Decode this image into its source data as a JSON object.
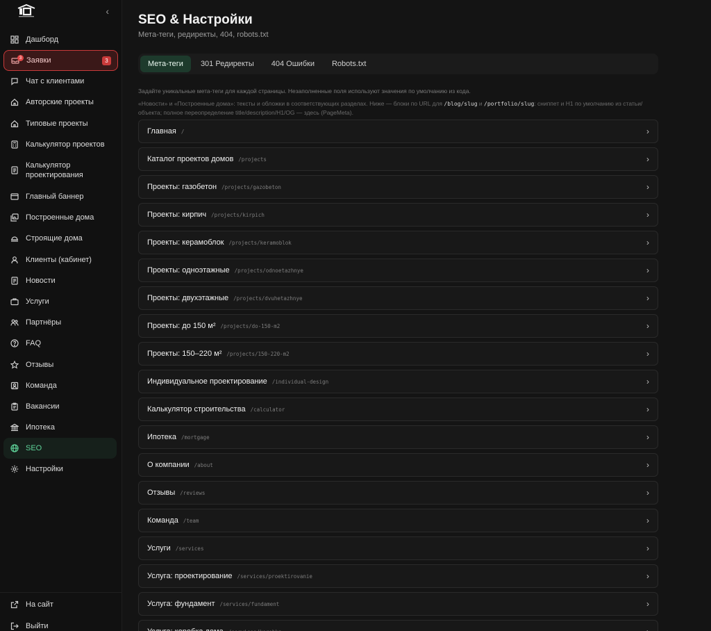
{
  "sidebar": {
    "collapse_glyph": "‹",
    "items": [
      {
        "label": "Дашборд",
        "icon": "dashboard-icon"
      },
      {
        "label": "Заявки",
        "icon": "inbox-icon",
        "dot": "3",
        "count": "3"
      },
      {
        "label": "Чат с клиентами",
        "icon": "chat-icon"
      },
      {
        "label": "Авторские проекты",
        "icon": "home-icon"
      },
      {
        "label": "Типовые проекты",
        "icon": "home-icon"
      },
      {
        "label": "Калькулятор проектов",
        "icon": "calculator-icon"
      },
      {
        "label": "Калькулятор проектирования",
        "icon": "document-icon"
      },
      {
        "label": "Главный баннер",
        "icon": "banner-icon"
      },
      {
        "label": "Построенные дома",
        "icon": "gallery-icon"
      },
      {
        "label": "Строящие дома",
        "icon": "construction-icon"
      },
      {
        "label": "Клиенты (кабинет)",
        "icon": "user-icon"
      },
      {
        "label": "Новости",
        "icon": "news-icon"
      },
      {
        "label": "Услуги",
        "icon": "briefcase-icon"
      },
      {
        "label": "Партнёры",
        "icon": "partners-icon"
      },
      {
        "label": "FAQ",
        "icon": "question-icon"
      },
      {
        "label": "Отзывы",
        "icon": "star-icon"
      },
      {
        "label": "Команда",
        "icon": "team-icon"
      },
      {
        "label": "Вакансии",
        "icon": "clipboard-icon"
      },
      {
        "label": "Ипотека",
        "icon": "bank-icon"
      },
      {
        "label": "SEO",
        "icon": "globe-icon"
      },
      {
        "label": "Настройки",
        "icon": "gear-icon"
      }
    ],
    "bottom": [
      {
        "label": "На сайт",
        "icon": "external-link-icon"
      },
      {
        "label": "Выйти",
        "icon": "logout-icon"
      }
    ]
  },
  "header": {
    "title": "SEO & Настройки",
    "subtitle": "Мета-теги, редиректы, 404, robots.txt"
  },
  "tabs": [
    {
      "label": "Мета-теги",
      "active": true
    },
    {
      "label": "301 Редиректы",
      "active": false
    },
    {
      "label": "404 Ошибки",
      "active": false
    },
    {
      "label": "Robots.txt",
      "active": false
    }
  ],
  "hints": {
    "line1": "Задайте уникальные мета-теги для каждой страницы. Незаполненные поля используют значения по умолчанию из кода.",
    "line2_a": "«Новости» и «Построенные дома»: тексты и обложки в соответствующих разделах. Ниже — блоки по URL для ",
    "code1": "/blog/slug",
    "line2_b": " и ",
    "code2": "/portfolio/slug",
    "line2_c": ": сниппет и H1 по умолчанию из статьи/объекта; полное переопределение title/description/H1/OG — здесь (PageMeta)."
  },
  "pages": [
    {
      "title": "Главная",
      "path": "/"
    },
    {
      "title": "Каталог проектов домов",
      "path": "/projects"
    },
    {
      "title": "Проекты: газобетон",
      "path": "/projects/gazobeton"
    },
    {
      "title": "Проекты: кирпич",
      "path": "/projects/kirpich"
    },
    {
      "title": "Проекты: керамоблок",
      "path": "/projects/keramoblok"
    },
    {
      "title": "Проекты: одноэтажные",
      "path": "/projects/odnoetazhnye"
    },
    {
      "title": "Проекты: двухэтажные",
      "path": "/projects/dvuhetazhnye"
    },
    {
      "title": "Проекты: до 150 м²",
      "path": "/projects/do-150-m2"
    },
    {
      "title": "Проекты: 150–220 м²",
      "path": "/projects/150-220-m2"
    },
    {
      "title": "Индивидуальное проектирование",
      "path": "/individual-design"
    },
    {
      "title": "Калькулятор строительства",
      "path": "/calculator"
    },
    {
      "title": "Ипотека",
      "path": "/mortgage"
    },
    {
      "title": "О компании",
      "path": "/about"
    },
    {
      "title": "Отзывы",
      "path": "/reviews"
    },
    {
      "title": "Команда",
      "path": "/team"
    },
    {
      "title": "Услуги",
      "path": "/services"
    },
    {
      "title": "Услуга: проектирование",
      "path": "/services/proektirovanie"
    },
    {
      "title": "Услуга: фундамент",
      "path": "/services/fundament"
    },
    {
      "title": "Услуга: коробка дома",
      "path": "/services/korobka"
    }
  ],
  "chevron_glyph": "›",
  "colors": {
    "accent": "#5fd39a",
    "tab_active_bg": "#1d3a2c",
    "alert": "#c93a3a"
  }
}
